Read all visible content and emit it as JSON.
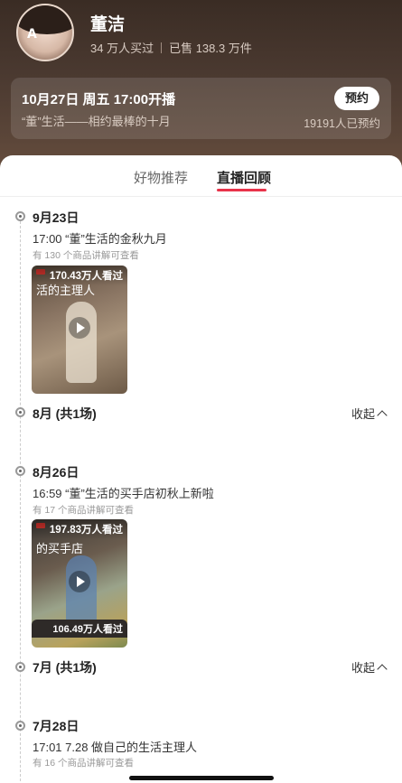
{
  "profile": {
    "name": "董洁",
    "buyers": "34 万人买过",
    "sold": "已售 138.3 万件",
    "avatar_doodle": "A"
  },
  "upcoming_live": {
    "title": "10月27日 周五 17:00开播",
    "subtitle": "“董”生活——相约最棒的十月",
    "reserve_label": "预约",
    "reserve_count": "19191人已预约"
  },
  "tabs": [
    {
      "label": "好物推荐",
      "active": false
    },
    {
      "label": "直播回顾",
      "active": true
    }
  ],
  "accent_color": "#e8334a",
  "replays": [
    {
      "date": "9月23日",
      "title": "17:00 “董”生活的金秋九月",
      "note": "有 130 个商品讲解可查看",
      "views": "170.43万人看过",
      "cover_text": "活的主理人"
    },
    {
      "date": "8月26日",
      "title": "16:59 “董”生活的买手店初秋上新啦",
      "note": "有 17 个商品讲解可查看",
      "views": "197.83万人看过",
      "cover_text": "的买手店"
    },
    {
      "date": "7月28日",
      "title": "17:01  7.28 做自己的生活主理人",
      "note": "有 16 个商品讲解可查看",
      "views": "106.49万人看过"
    }
  ],
  "months": [
    {
      "label": "8月 (共1场)",
      "collapse_label": "收起"
    },
    {
      "label": "7月 (共1场)",
      "collapse_label": "收起"
    }
  ]
}
